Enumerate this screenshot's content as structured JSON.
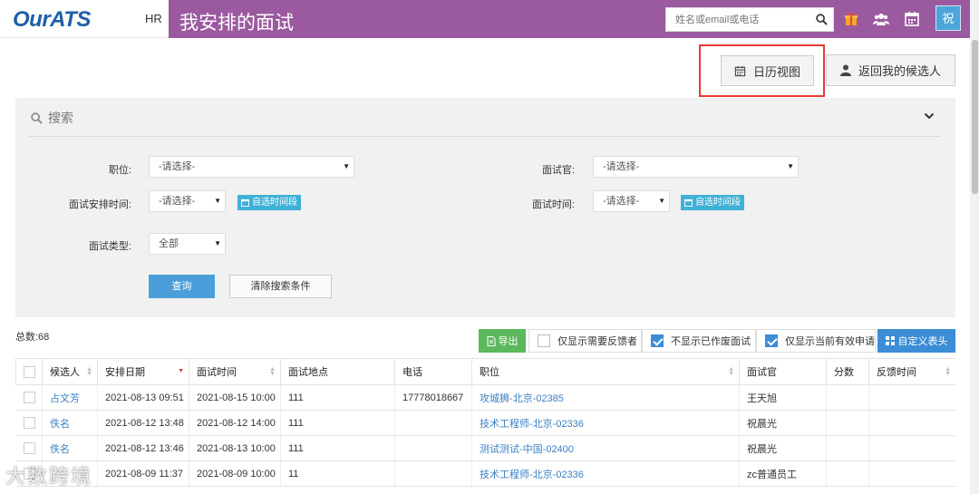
{
  "header": {
    "logo": "OurATS",
    "role": "HR",
    "title": "我安排的面试",
    "search_placeholder": "姓名或email或电话",
    "user_badge": "祝",
    "colors": {
      "bar": "#9b5aa0",
      "badge": "#4ea5d9"
    }
  },
  "actions": {
    "calendar_view": "日历视图",
    "back_to_candidates": "返回我的候选人"
  },
  "search_panel": {
    "title": "搜索",
    "position_label": "职位:",
    "position_value": "-请选择-",
    "interviewer_label": "面试官:",
    "interviewer_value": "-请选择-",
    "arrange_time_label": "面试安排时间:",
    "arrange_time_value": "-请选择-",
    "interview_time_label": "面试时间:",
    "interview_time_value": "-请选择-",
    "custom_range_label": "自选时间段",
    "type_label": "面试类型:",
    "type_value": "全部",
    "query_button": "查询",
    "clear_button": "清除搜索条件"
  },
  "toolbar": {
    "total": "总数:68",
    "export": "导出",
    "opt_feedback": "仅显示需要反馈者",
    "opt_feedback_checked": false,
    "opt_hide_cancelled": "不显示已作废面试",
    "opt_hide_cancelled_checked": true,
    "opt_valid_only": "仅显示当前有效申请",
    "opt_valid_only_checked": true,
    "custom_header": "自定义表头"
  },
  "table": {
    "columns": [
      "候选人",
      "安排日期",
      "面试时间",
      "面试地点",
      "电话",
      "职位",
      "面试官",
      "分数",
      "反馈时间"
    ],
    "rows": [
      {
        "candidate": "占文芳",
        "arranged": "2021-08-13 09:51",
        "time": "2021-08-15 10:00",
        "place": "111",
        "phone": "17778018667",
        "position": "攻城狮-北京-02385",
        "interviewer": "王天旭",
        "score": "",
        "feedback": ""
      },
      {
        "candidate": "佚名",
        "arranged": "2021-08-12 13:48",
        "time": "2021-08-12 14:00",
        "place": "111",
        "phone": "",
        "position": "技术工程师-北京-02336",
        "interviewer": "祝晨光",
        "score": "",
        "feedback": ""
      },
      {
        "candidate": "佚名",
        "arranged": "2021-08-12 13:46",
        "time": "2021-08-13 10:00",
        "place": "111",
        "phone": "",
        "position": "测试测试-中国-02400",
        "interviewer": "祝晨光",
        "score": "",
        "feedback": ""
      },
      {
        "candidate": "",
        "arranged": "2021-08-09 11:37",
        "time": "2021-08-09 10:00",
        "place": "11",
        "phone": "",
        "position": "技术工程师-北京-02336",
        "interviewer": "zc普通员工",
        "score": "",
        "feedback": ""
      }
    ]
  },
  "watermark": "大数跨境"
}
